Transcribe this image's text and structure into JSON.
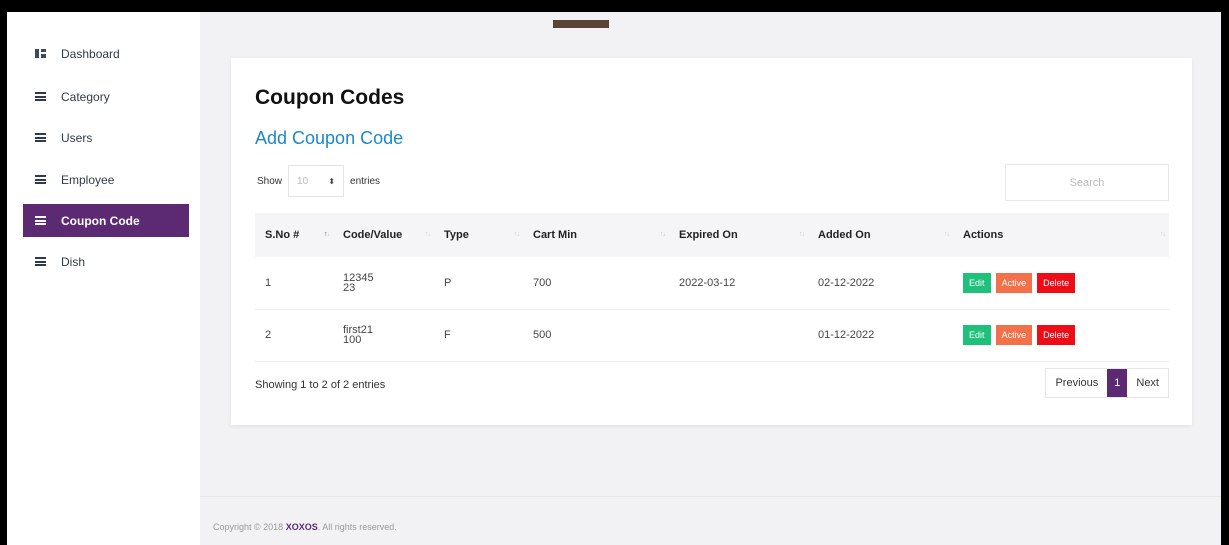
{
  "sidebar": {
    "items": [
      {
        "label": "Dashboard",
        "icon": "dashboard-icon"
      },
      {
        "label": "Category",
        "icon": "menu-icon"
      },
      {
        "label": "Users",
        "icon": "menu-icon"
      },
      {
        "label": "Employee",
        "icon": "menu-icon"
      },
      {
        "label": "Coupon Code",
        "icon": "menu-icon",
        "active": true
      },
      {
        "label": "Dish",
        "icon": "menu-icon"
      }
    ]
  },
  "page": {
    "title": "Coupon Codes",
    "add_link": "Add Coupon Code"
  },
  "controls": {
    "show_label": "Show",
    "entries_label": "entries",
    "page_length": "10",
    "search_placeholder": "Search"
  },
  "table": {
    "columns": [
      "S.No #",
      "Code/Value",
      "Type",
      "Cart Min",
      "Expired On",
      "Added On",
      "Actions"
    ],
    "rows": [
      {
        "sno": "1",
        "code_line1": "12345",
        "code_line2": "23",
        "type": "P",
        "cart_min": "700",
        "expired_on": "2022-03-12",
        "added_on": "02-12-2022"
      },
      {
        "sno": "2",
        "code_line1": "first21",
        "code_line2": "100",
        "type": "F",
        "cart_min": "500",
        "expired_on": "",
        "added_on": "01-12-2022"
      }
    ],
    "actions": {
      "edit": "Edit",
      "active": "Active",
      "delete": "Delete"
    }
  },
  "footer_table": {
    "info": "Showing 1 to 2 of 2 entries",
    "previous": "Previous",
    "current_page": "1",
    "next": "Next"
  },
  "footer": {
    "prefix": "Copyright © 2018 ",
    "brand": "XOXOS",
    "suffix": ". All rights reserved."
  },
  "colors": {
    "accent": "#5b2a73",
    "link": "#1b88c9",
    "edit": "#1fc07a",
    "active": "#f2714a",
    "delete": "#ee0d16"
  }
}
